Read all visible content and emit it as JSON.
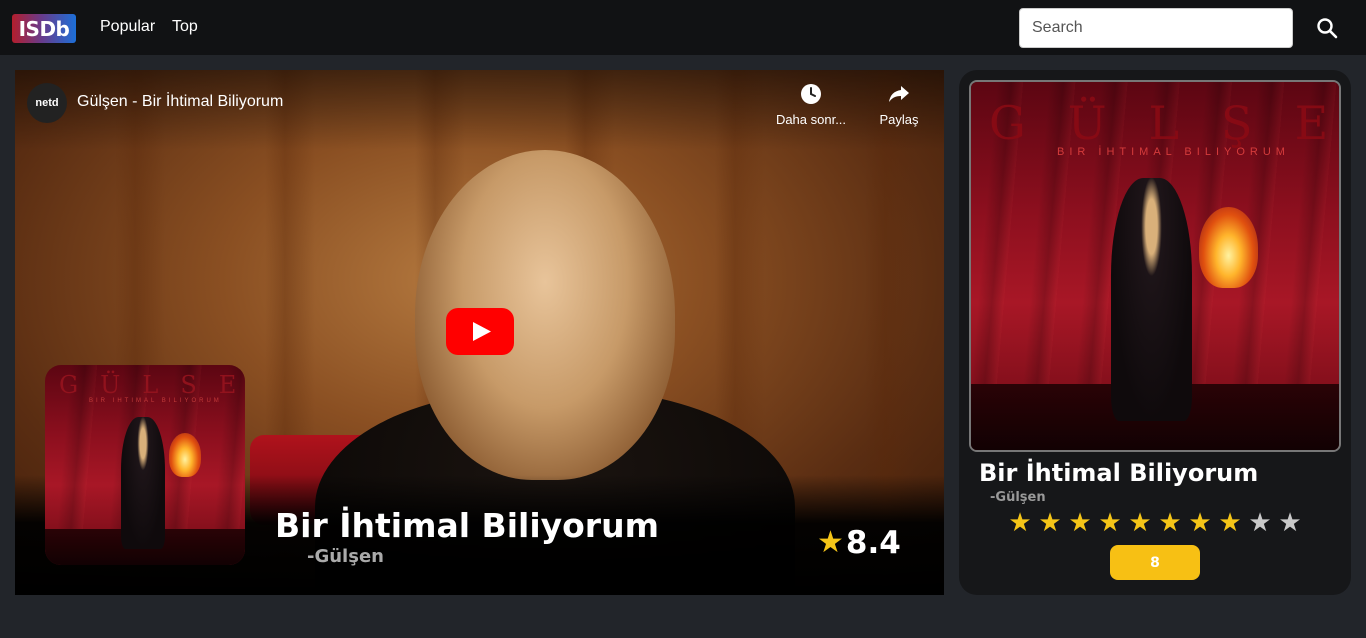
{
  "navbar": {
    "logo_text": "ISDb",
    "links": [
      "Popular",
      "Top"
    ],
    "search_placeholder": "Search"
  },
  "video": {
    "channel": "netd",
    "title": "Gülşen - Bir İhtimal Biliyorum",
    "watch_later_label": "Daha sonr...",
    "share_label": "Paylaş",
    "thumb_art_title": "GÜLSEN",
    "thumb_art_subtitle": "BIR IHTIMAL BILIYORUM"
  },
  "song": {
    "title": "Bir İhtimal Biliyorum",
    "artist": "-Gülşen",
    "rating": "8.4"
  },
  "card": {
    "cover_art_title": "GÜLŞEN",
    "cover_art_subtitle": "BIR İHTIMAL BILIYORUM",
    "title": "Bir İhtimal Biliyorum",
    "artist": "-Gülşen",
    "stars_total": 10,
    "stars_filled": 8,
    "score": "8"
  },
  "colors": {
    "accent_star": "#f5c518",
    "score_button": "#f7c014",
    "youtube_red": "#ff0000"
  }
}
